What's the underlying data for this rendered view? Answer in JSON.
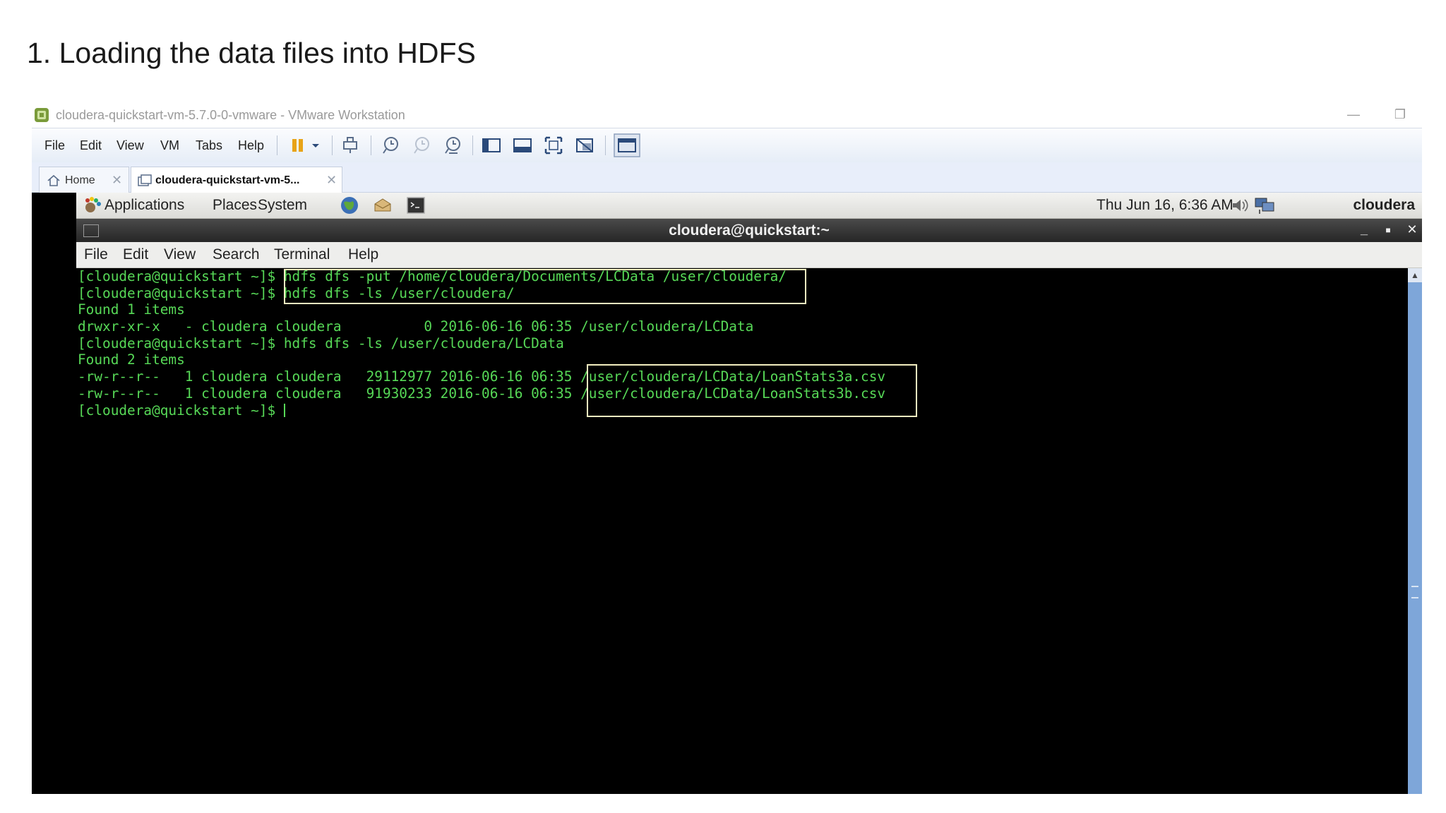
{
  "slide": {
    "title": "1. Loading the data files into HDFS"
  },
  "vmware": {
    "window_title": "cloudera-quickstart-vm-5.7.0-0-vmware - VMware Workstation",
    "menus": [
      "File",
      "Edit",
      "View",
      "VM",
      "Tabs",
      "Help"
    ],
    "tabs": [
      {
        "label": "Home",
        "active": false
      },
      {
        "label": "cloudera-quickstart-vm-5...",
        "active": true
      }
    ]
  },
  "gnome_panel": {
    "menus": [
      "Applications",
      "Places",
      "System"
    ],
    "clock": "Thu Jun 16,  6:36 AM",
    "user": "cloudera"
  },
  "terminal": {
    "title": "cloudera@quickstart:~",
    "menus": [
      "File",
      "Edit",
      "View",
      "Search",
      "Terminal",
      "Help"
    ],
    "prompt": "[cloudera@quickstart ~]$ ",
    "lines": [
      "[cloudera@quickstart ~]$ hdfs dfs -put /home/cloudera/Documents/LCData /user/cloudera/",
      "[cloudera@quickstart ~]$ hdfs dfs -ls /user/cloudera/",
      "Found 1 items",
      "drwxr-xr-x   - cloudera cloudera          0 2016-06-16 06:35 /user/cloudera/LCData",
      "[cloudera@quickstart ~]$ hdfs dfs -ls /user/cloudera/LCData",
      "Found 2 items",
      "-rw-r--r--   1 cloudera cloudera   29112977 2016-06-16 06:35 /user/cloudera/LCData/LoanStats3a.csv",
      "-rw-r--r--   1 cloudera cloudera   91930233 2016-06-16 06:35 /user/cloudera/LCData/LoanStats3b.csv"
    ]
  },
  "colors": {
    "terminal_text": "#57d957",
    "highlight_box": "#f3eec0"
  }
}
